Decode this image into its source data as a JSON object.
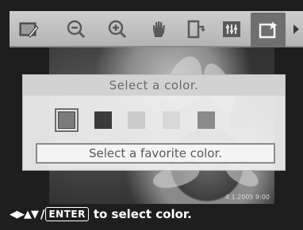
{
  "toolbar": {
    "items": [
      {
        "icon": "edit-image-icon"
      },
      {
        "icon": "zoom-out-icon"
      },
      {
        "icon": "zoom-in-icon"
      },
      {
        "icon": "hand-pan-icon"
      },
      {
        "icon": "rotate-icon"
      },
      {
        "icon": "adjust-icon"
      },
      {
        "icon": "add-frame-icon",
        "selected": true
      }
    ],
    "more_icon": "right-arrow-icon"
  },
  "photo": {
    "date_stamp": "4.1.2005 9:00"
  },
  "dialog": {
    "title": "Select a color.",
    "swatches": [
      {
        "color": "#7b7b7b",
        "selected": true
      },
      {
        "color": "#3b3b3b"
      },
      {
        "color": "#cbcbcb"
      },
      {
        "color": "#d8d8d8"
      },
      {
        "color": "#8a8a8a"
      },
      {
        "color": "#e4e4e4"
      }
    ],
    "favorite_button_label": "Select a favorite color."
  },
  "hint": {
    "arrows": "◀▶▲▼",
    "slash": "/",
    "key_label": "ENTER",
    "text": "to select color."
  }
}
